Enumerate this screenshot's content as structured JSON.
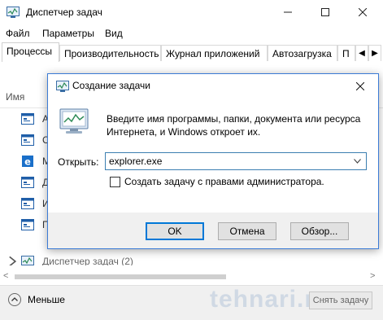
{
  "task_manager": {
    "title": "Диспетчер задач",
    "menu": [
      "Файл",
      "Параметры",
      "Вид"
    ],
    "tabs": [
      "Процессы",
      "Производительность",
      "Журнал приложений",
      "Автозагрузка",
      "П"
    ],
    "column_header": "Имя",
    "rows": [
      "А",
      "С",
      "М",
      "Д",
      "И",
      "П",
      "Диспетчер задач (2)"
    ],
    "footer": {
      "fewer_label": "Меньше",
      "watermark": "tehnari.ru",
      "end_task_button": "Снять задачу"
    }
  },
  "run_dialog": {
    "title": "Создание задачи",
    "description": "Введите имя программы, папки, документа или ресурса Интернета, и Windows откроет их.",
    "open_label": "Открыть:",
    "open_value": "explorer.exe",
    "admin_checkbox_label": "Создать задачу с правами администратора.",
    "admin_checked": false,
    "buttons": {
      "ok": "OK",
      "cancel": "Отмена",
      "browse": "Обзор..."
    }
  },
  "colors": {
    "dialog_border": "#3b7bd6",
    "input_border": "#3c7fb1",
    "ok_focus": "#0078d7",
    "footer_bg": "#f0f0f0"
  }
}
